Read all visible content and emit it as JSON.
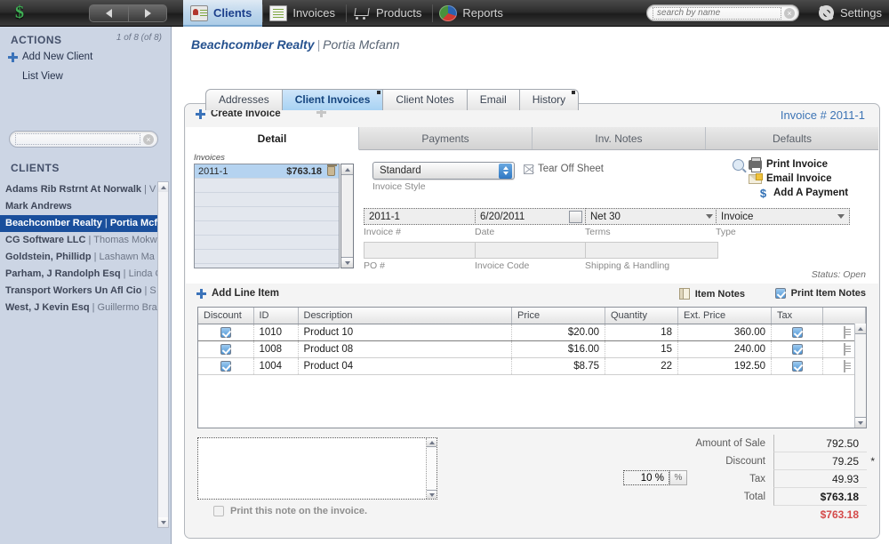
{
  "toolbar": {
    "logo": "dollar-logo",
    "nav_back": "back-arrow",
    "nav_forward": "forward-arrow",
    "tabs": [
      {
        "label": "Clients",
        "icon": "clients-icon",
        "active": true
      },
      {
        "label": "Invoices",
        "icon": "invoices-icon",
        "active": false
      },
      {
        "label": "Products",
        "icon": "products-icon",
        "active": false
      },
      {
        "label": "Reports",
        "icon": "reports-icon",
        "active": false
      }
    ],
    "search_placeholder": "search by name",
    "search_value": "",
    "settings_label": "Settings"
  },
  "sidebar": {
    "actions_header": "ACTIONS",
    "counter": "1 of 8 (of 8)",
    "actions": [
      {
        "label": "Add New Client"
      },
      {
        "label": "List View"
      }
    ],
    "search_value": "",
    "clients_header": "CLIENTS",
    "clients": [
      {
        "name": "Adams Rib Rstrnt At Norwalk",
        "contact": "V",
        "selected": false
      },
      {
        "name": "Mark Andrews",
        "contact": "",
        "selected": false
      },
      {
        "name": "Beachcomber Realty",
        "contact": "Portia Mcf",
        "selected": true
      },
      {
        "name": "CG Software LLC",
        "contact": "Thomas Mokw",
        "selected": false
      },
      {
        "name": "Goldstein, Phillidp",
        "contact": "Lashawn Ma",
        "selected": false
      },
      {
        "name": "Parham, J Randolph Esq",
        "contact": "Linda C",
        "selected": false
      },
      {
        "name": "Transport Workers Un Afl Cio",
        "contact": "S",
        "selected": false
      },
      {
        "name": "West, J Kevin Esq",
        "contact": "Guillermo Bra",
        "selected": false
      }
    ]
  },
  "breadcrumb": {
    "client": "Beachcomber Realty",
    "separator": "|",
    "contact": "Portia Mcfann"
  },
  "client_tabs": [
    {
      "label": "Addresses",
      "active": false
    },
    {
      "label": "Client Invoices",
      "active": true
    },
    {
      "label": "Client Notes",
      "active": false
    },
    {
      "label": "Email",
      "active": false
    },
    {
      "label": "History",
      "active": false
    }
  ],
  "invoice_panel": {
    "create_label": "Create Invoice",
    "invoice_number_label": "Invoice # 2011-1",
    "subtabs": [
      {
        "label": "Detail",
        "active": true
      },
      {
        "label": "Payments",
        "active": false
      },
      {
        "label": "Inv. Notes",
        "active": false
      },
      {
        "label": "Defaults",
        "active": false
      }
    ],
    "invoices_list_label": "Invoices",
    "invoices": [
      {
        "number": "2011-1",
        "amount": "$763.18",
        "selected": true
      }
    ],
    "style": {
      "value": "Standard",
      "label": "Invoice Style"
    },
    "tear_off_label": "Tear Off Sheet",
    "fields": [
      {
        "value": "2011-1",
        "label": "Invoice #"
      },
      {
        "value": "6/20/2011",
        "label": "Date"
      },
      {
        "value": "Net 30",
        "label": "Terms"
      },
      {
        "value": "Invoice",
        "label": "Type"
      },
      {
        "value": "",
        "label": "PO #"
      },
      {
        "value": "",
        "label": "Invoice Code"
      },
      {
        "value": "",
        "label": "Shipping & Handling"
      }
    ],
    "actions": [
      {
        "label": "Print Invoice",
        "icon": "printer-icon"
      },
      {
        "label": "Email Invoice",
        "icon": "envelope-icon"
      },
      {
        "label": "Add A Payment",
        "icon": "dollar-icon"
      }
    ],
    "status": "Status: Open"
  },
  "line_items": {
    "add_label": "Add Line Item",
    "item_notes_label": "Item Notes",
    "print_item_notes_label": "Print Item Notes",
    "print_item_notes_checked": true,
    "columns": [
      "Discount",
      "ID",
      "Description",
      "Price",
      "Quantity",
      "Ext. Price",
      "Tax",
      ""
    ],
    "rows": [
      {
        "discount": true,
        "id": "1010",
        "description": "Product 10",
        "price": "$20.00",
        "quantity": "18",
        "ext_price": "360.00",
        "tax": true
      },
      {
        "discount": true,
        "id": "1008",
        "description": "Product 08",
        "price": "$16.00",
        "quantity": "15",
        "ext_price": "240.00",
        "tax": true
      },
      {
        "discount": true,
        "id": "1004",
        "description": "Product 04",
        "price": "$8.75",
        "quantity": "22",
        "ext_price": "192.50",
        "tax": true
      }
    ]
  },
  "note": {
    "value": "",
    "print_note_label": "Print this note on the invoice."
  },
  "totals": {
    "discount_percent": "10 %",
    "percent_button": "%",
    "rows": [
      {
        "label": "Amount of Sale",
        "value": "792.50",
        "star": false
      },
      {
        "label": "Discount",
        "value": "79.25",
        "star": true
      },
      {
        "label": "Tax",
        "value": "49.93",
        "star": false
      },
      {
        "label": "Total",
        "value": "$763.18",
        "star": false
      }
    ],
    "balance_due": "$763.18"
  },
  "colors": {
    "accent_blue": "#3d74b5",
    "selection_blue": "#1a4f9c",
    "tab_active": "#a8d2f3",
    "red_total": "#d44a4a",
    "sidebar_bg": "#ccd5e4"
  }
}
